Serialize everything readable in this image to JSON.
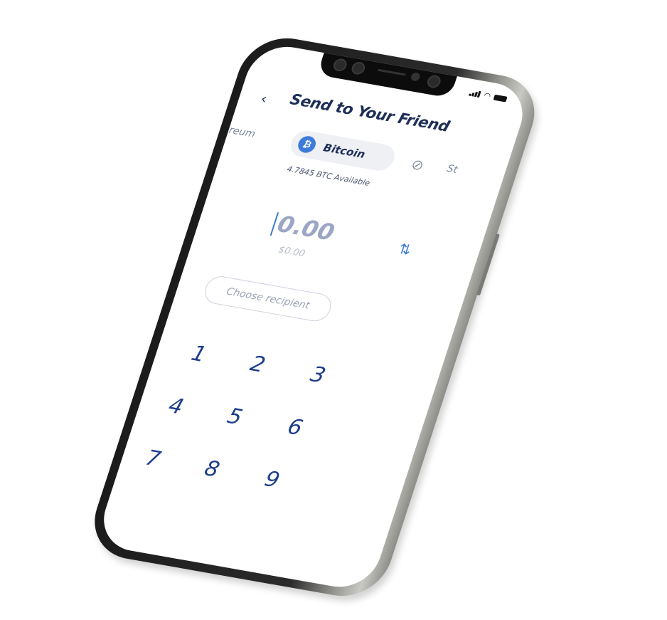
{
  "header": {
    "title": "Send to Your Friend",
    "back_icon": "chevron-left-icon"
  },
  "coins": {
    "left": "ereum",
    "selected": {
      "name": "Bitcoin",
      "symbol": "₿"
    },
    "right": "St",
    "right_icon": "stellar-icon"
  },
  "available": "4.7845 BTC Available",
  "amount": {
    "value": "0.00",
    "fiat": "$0.00"
  },
  "recipient": {
    "label": "Choose recipient"
  },
  "keypad": {
    "k1": "1",
    "k2": "2",
    "k3": "3",
    "k4": "4",
    "k5": "5",
    "k6": "6",
    "k7": "7",
    "k8": "8",
    "k9": "9"
  },
  "colors": {
    "accent": "#3d7bd9",
    "text": "#1e2f57",
    "key": "#1e3f8a"
  }
}
